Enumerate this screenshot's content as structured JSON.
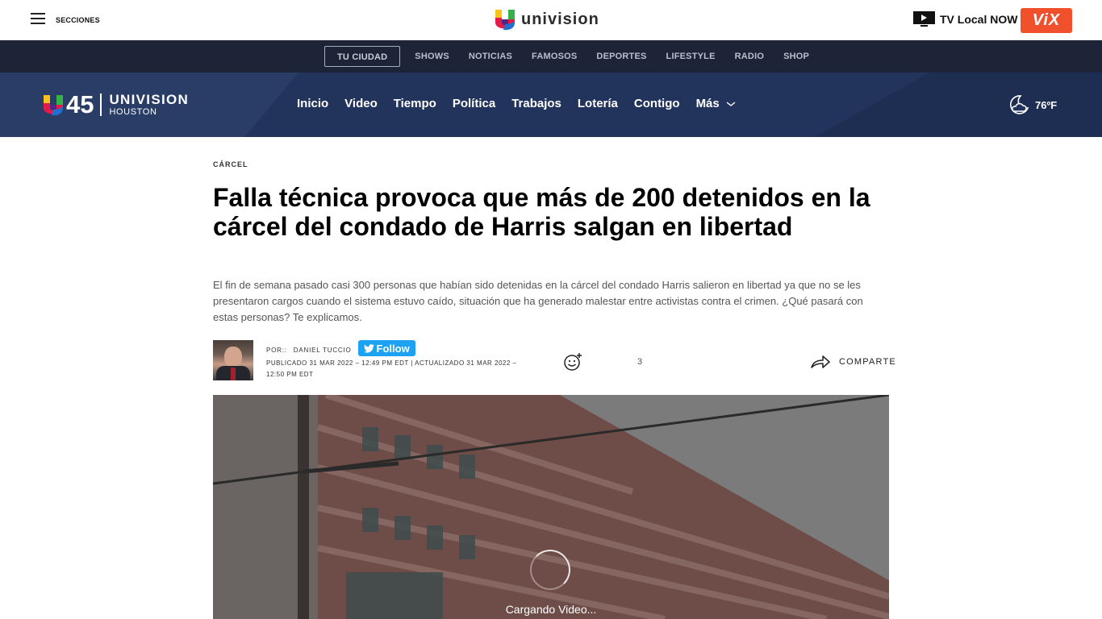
{
  "topbar": {
    "sections_label": "SECCIONES",
    "brand": "univision",
    "tv_local": "TV Local NOW",
    "vix": "ViX"
  },
  "secondary_nav": {
    "items": [
      "TU CIUDAD",
      "SHOWS",
      "NOTICIAS",
      "FAMOSOS",
      "DEPORTES",
      "LIFESTYLE",
      "RADIO",
      "SHOP"
    ]
  },
  "local": {
    "logo_number": "45",
    "logo_brand": "UNIVISION",
    "logo_city": "HOUSTON",
    "nav": [
      "Inicio",
      "Video",
      "Tiempo",
      "Política",
      "Trabajos",
      "Lotería",
      "Contigo",
      "Más"
    ],
    "weather": "76ºF"
  },
  "article": {
    "kicker": "CÁRCEL",
    "headline": "Falla técnica provoca que más de 200 detenidos en la cárcel del condado de Harris salgan en libertad",
    "dek": "El fin de semana pasado casi 300 personas que habían sido detenidas en la cárcel del condado Harris salieron en libertad ya que no se les presentaron cargos cuando el sistema estuvo caído, situación que ha generado malestar entre activistas contra el crimen. ¿Qué pasará con estas personas? Te explicamos.",
    "by_prefix": "POR::",
    "author": "DANIEL TUCCIO",
    "follow": "Follow",
    "published": "PUBLICADO 31 MAR 2022 – 12:49 PM EDT | ACTUALIZADO 31 MAR 2022 – 12:50 PM EDT",
    "reaction_count": "3",
    "share": "COMPARTE"
  },
  "video": {
    "loading": "Cargando Video..."
  },
  "colors": {
    "secondary_nav_bg": "#1d2437",
    "local_bar_bg": "#22345c",
    "vix": "#f0502c",
    "twitter": "#1da1f2"
  }
}
